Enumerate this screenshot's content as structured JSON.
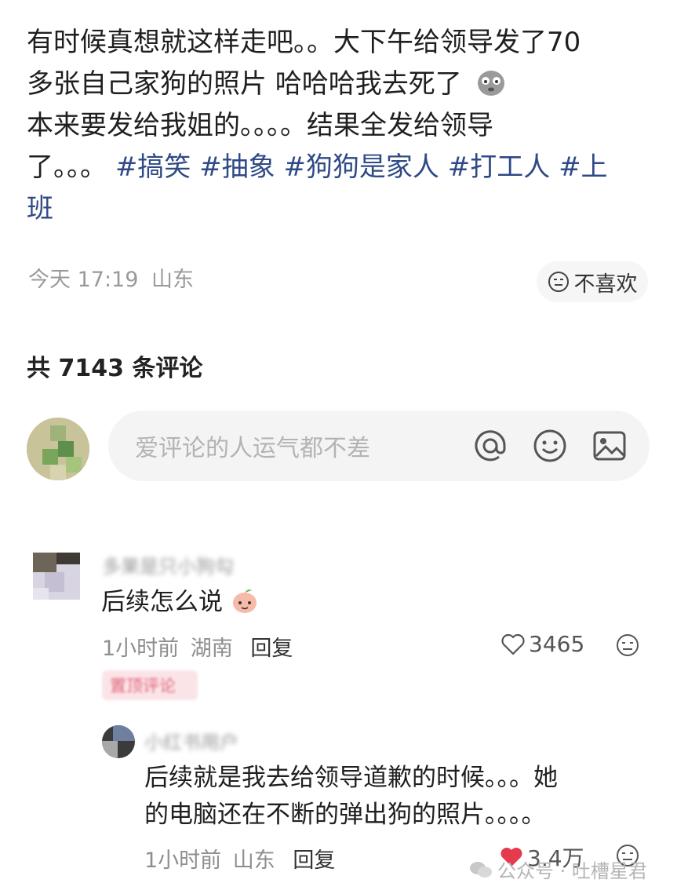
{
  "post": {
    "line1": "有时候真想就这样走吧。。大下午给领导发了70",
    "line2": "多张自己家狗的照片 哈哈哈我去死了",
    "line3": "本来要发给我姐的。。。。结果全发给领导",
    "line4_prefix": "了。。。",
    "tags": [
      "#搞笑",
      "#抽象",
      "#狗狗是家人",
      "#打工人",
      "#上"
    ],
    "line5": "班",
    "time": "今天 17:19",
    "location": "山东",
    "dislike_label": "不喜欢"
  },
  "comments_header": "共 7143 条评论",
  "comment_input": {
    "placeholder": "爱评论的人运气都不差"
  },
  "comments": [
    {
      "name": "多果是只小狗勾",
      "text": "后续怎么说",
      "time": "1小时前",
      "location": "湖南",
      "reply_label": "回复",
      "likes": "3465",
      "badge": "置顶评论"
    }
  ],
  "reply": {
    "name": "小红书用户",
    "text_line1": "后续就是我去给领导道歉的时候。。。她",
    "text_line2": "的电脑还在不断的弹出狗的照片。。。。",
    "time": "1小时前",
    "location": "山东",
    "reply_label": "回复",
    "likes": "3.4万"
  },
  "watermark": "公众号 · 吐槽星君",
  "colors": {
    "tag": "#2f4a86",
    "like_red": "#e5394d",
    "badge_bg": "#fbe4e8"
  }
}
